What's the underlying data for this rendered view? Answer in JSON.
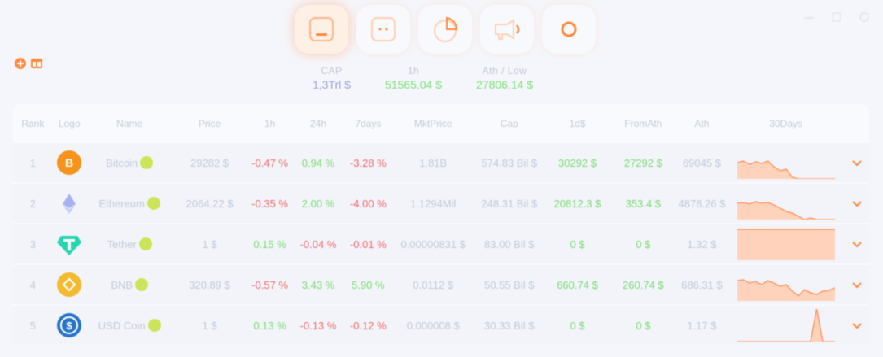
{
  "nav": {
    "items": [
      {
        "name": "dashboard",
        "icon": "dashboard-icon",
        "active": true
      },
      {
        "name": "dots",
        "icon": "dots-icon",
        "active": false
      },
      {
        "name": "pie",
        "icon": "pie-chart-icon",
        "active": false
      },
      {
        "name": "announce",
        "icon": "megaphone-icon",
        "active": false
      },
      {
        "name": "ring",
        "icon": "ring-icon",
        "active": false
      }
    ]
  },
  "stats": [
    {
      "label": "CAP",
      "value": "1,3Trl $",
      "color": "purple"
    },
    {
      "label": "1h",
      "value": "51565.04 $",
      "color": "green"
    },
    {
      "label": "Ath / Low",
      "value": "27806.14 $",
      "color": "green"
    }
  ],
  "table": {
    "headers": [
      "Rank",
      "Logo",
      "Name",
      "Price",
      "1h",
      "24h",
      "7days",
      "MktPrice",
      "Cap",
      "1d$",
      "FromAth",
      "Ath",
      "30Days"
    ],
    "rows": [
      {
        "rank": "1",
        "logo": "bitcoin-icon",
        "name": "Bitcoin",
        "price": "29282 $",
        "h1": "-0.47 %",
        "h1s": "neg",
        "h24": "0.94 %",
        "h24s": "pos",
        "d7": "-3.28 %",
        "d7s": "neg",
        "mkt": "1.81B",
        "cap": "574.83 Bil $",
        "ath": "30292 $",
        "fromath": "27292 $",
        "ath2": "69045 $",
        "spark": [
          20,
          18,
          22,
          19,
          21,
          18,
          25,
          30,
          28,
          38,
          45,
          42,
          44,
          40,
          43,
          41,
          42
        ]
      },
      {
        "rank": "2",
        "logo": "ethereum-icon",
        "name": "Ethereum",
        "price": "2064.22 $",
        "h1": "-0.35 %",
        "h1s": "neg",
        "h24": "2.00 %",
        "h24s": "pos",
        "d7": "-4.00 %",
        "d7s": "neg",
        "mkt": "1.1294Mil",
        "cap": "248.31 Bil $",
        "ath": "20812.3 $",
        "fromath": "353.4 $",
        "ath2": "4878.26 $",
        "spark": [
          20,
          19,
          21,
          18,
          20,
          19,
          22,
          26,
          30,
          32,
          36,
          40,
          38,
          44,
          41,
          43,
          40
        ]
      },
      {
        "rank": "3",
        "logo": "tether-icon",
        "name": "Tether",
        "price": "1 $",
        "h1": "0.15 %",
        "h1s": "pos",
        "h24": "-0.04 %",
        "h24s": "neg",
        "d7": "-0.01 %",
        "d7s": "neg",
        "mkt": "0.00000831 $",
        "cap": "83.00 Bil $",
        "ath": "0 $",
        "fromath": "0 $",
        "ath2": "1.32 $",
        "spark": [
          2,
          2,
          2,
          2,
          2,
          2,
          2,
          2,
          2,
          2,
          2,
          2,
          2,
          2,
          2,
          2,
          2
        ]
      },
      {
        "rank": "4",
        "logo": "bnb-icon",
        "name": "BNB",
        "price": "320.89 $",
        "h1": "-0.57 %",
        "h1s": "neg",
        "h24": "3.43 %",
        "h24s": "pos",
        "d7": "5.90 %",
        "d7s": "pos",
        "mkt": "0.0112 $",
        "cap": "50.55 Bil $",
        "ath": "660.74 $",
        "fromath": "260.74 $",
        "ath2": "686.31 $",
        "spark": [
          15,
          14,
          18,
          16,
          20,
          15,
          18,
          22,
          20,
          28,
          34,
          26,
          30,
          32,
          28,
          27,
          24
        ]
      },
      {
        "rank": "5",
        "logo": "usd-coin-icon",
        "name": "USD Coin",
        "price": "1 $",
        "h1": "0.13 %",
        "h1s": "pos",
        "h24": "-0.13 %",
        "h24s": "neg",
        "d7": "-0.12 %",
        "d7s": "neg",
        "mkt": "0.000008 $",
        "cap": "30.33 Bil $",
        "ath": "0 $",
        "fromath": "0 $",
        "ath2": "1.17 $",
        "spark": [
          40,
          40,
          40,
          40,
          40,
          40,
          40,
          40,
          40,
          40,
          40,
          40,
          40,
          0,
          40,
          40,
          40
        ]
      }
    ]
  },
  "colors": {
    "accent": "#ff8a3d",
    "positive": "#7ddc72",
    "negative": "#f26d6d"
  }
}
